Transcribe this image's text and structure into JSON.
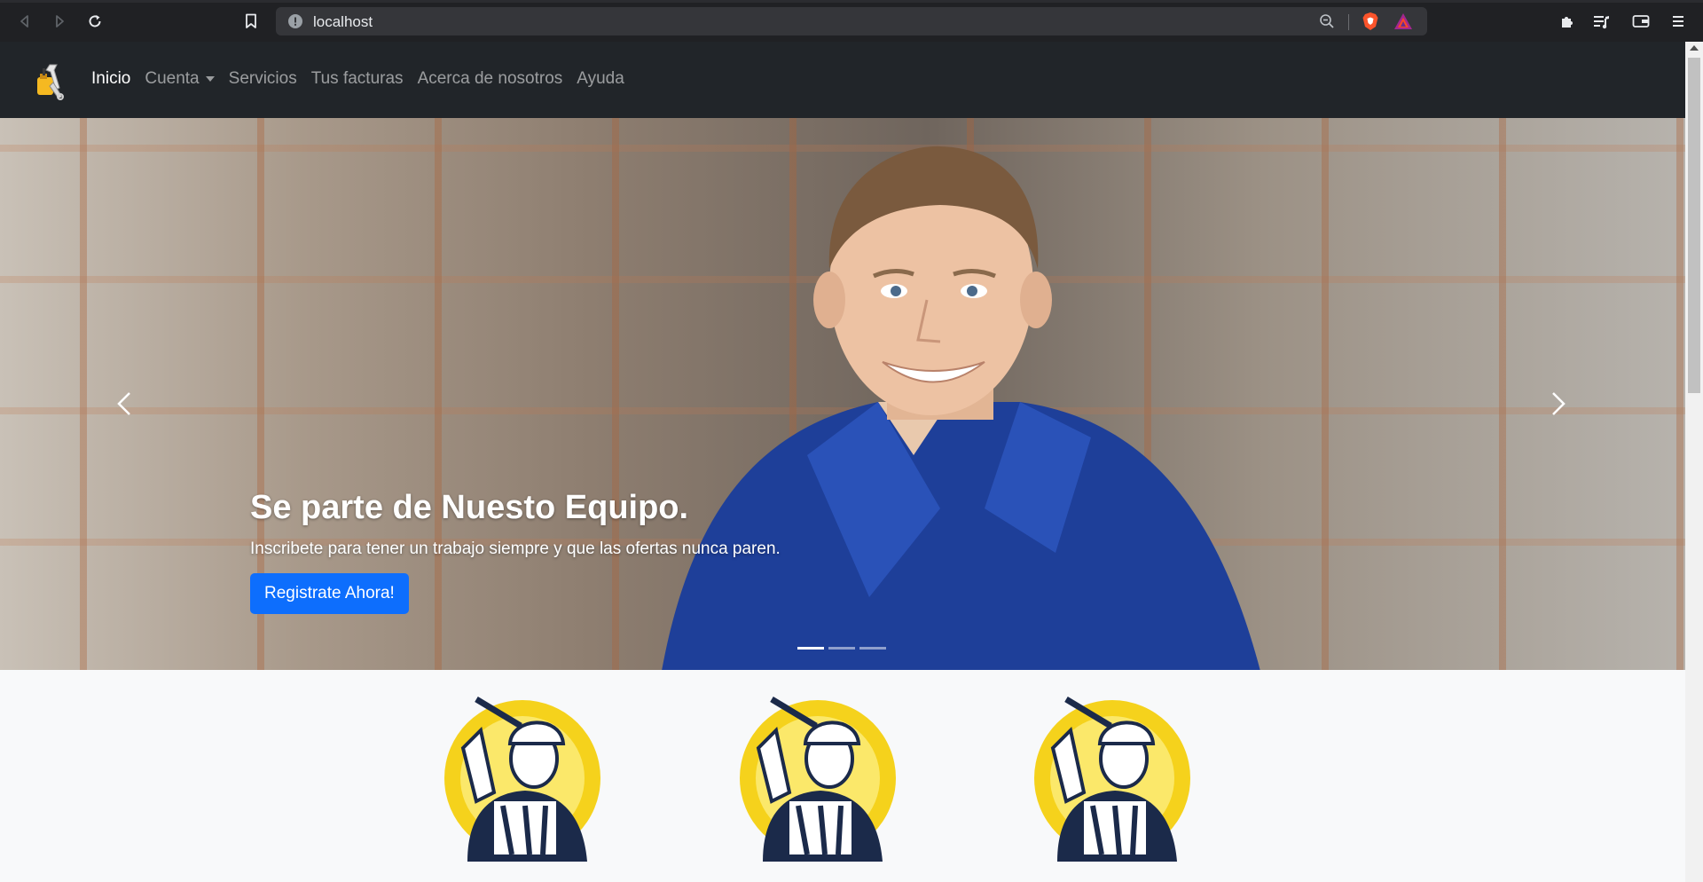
{
  "browser": {
    "url": "localhost"
  },
  "navbar": {
    "links": [
      {
        "label": "Inicio",
        "active": true
      },
      {
        "label": "Cuenta",
        "dropdown": true
      },
      {
        "label": "Servicios"
      },
      {
        "label": "Tus facturas"
      },
      {
        "label": "Acerca de nosotros"
      },
      {
        "label": "Ayuda"
      }
    ]
  },
  "carousel": {
    "title": "Se parte de Nuesto Equipo.",
    "text": "Inscribete para tener un trabajo siempre y que las ofertas nunca paren.",
    "cta_label": "Registrate Ahora!",
    "slides": 3,
    "active_slide": 1
  },
  "colors": {
    "navbar_bg": "#212529",
    "primary": "#0d6efd",
    "logo_yellow": "#f5d21c",
    "logo_navy": "#1b2a4a"
  },
  "cards": {
    "items": [
      {
        "icon": "worker-logo-icon"
      },
      {
        "icon": "worker-logo-icon"
      },
      {
        "icon": "worker-logo-icon"
      }
    ]
  }
}
